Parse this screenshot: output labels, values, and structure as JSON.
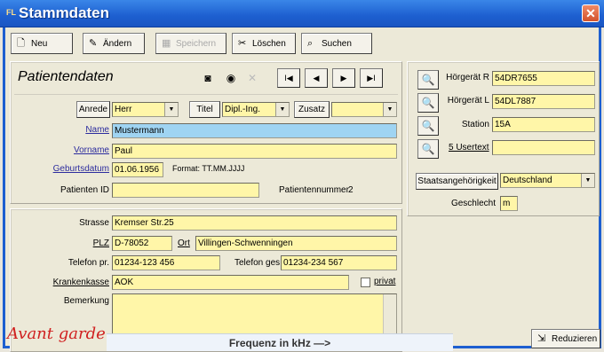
{
  "window": {
    "title": "Stammdaten",
    "app_icon": "FL"
  },
  "toolbar": {
    "new": "Neu",
    "edit": "Ändern",
    "save": "Speichern",
    "delete": "Löschen",
    "search": "Suchen",
    "reduce": "Reduzieren"
  },
  "patient": {
    "section_title": "Patientendaten",
    "anrede_label": "Anrede",
    "anrede_value": "Herr",
    "titel_label": "Titel",
    "titel_value": "Dipl.-Ing.",
    "zusatz_label": "Zusatz",
    "zusatz_value": "",
    "name_label": "Name",
    "name_value": "Mustermann",
    "vorname_label": "Vorname",
    "vorname_value": "Paul",
    "geburtsdatum_label": "Geburtsdatum",
    "geburtsdatum_value": "01.06.1956",
    "format_hint": "Format: TT.MM.JJJJ",
    "patienten_id_label": "Patienten ID",
    "patienten_id_value": "",
    "patientennummer_label": "Patientennummer",
    "patientennummer_value": "2"
  },
  "address": {
    "strasse_label": "Strasse",
    "strasse_value": "Kremser Str.25",
    "plz_label": "PLZ",
    "plz_value": "D-78052",
    "ort_label": "Ort",
    "ort_value": "Villingen-Schwenningen",
    "telefon_pr_label": "Telefon pr.",
    "telefon_pr_value": "01234-123 456",
    "telefon_ges_label": "Telefon ges.",
    "telefon_ges_value": "01234-234 567",
    "krankenkasse_label": "Krankenkasse",
    "krankenkasse_value": "AOK",
    "privat_label": "privat",
    "bemerkung_label": "Bemerkung",
    "bemerkung_value": ""
  },
  "device": {
    "hoergeraet_r_label": "Hörgerät R",
    "hoergeraet_r_value": "54DR7655",
    "hoergeraet_l_label": "Hörgerät L",
    "hoergeraet_l_value": "54DL7887",
    "station_label": "Station",
    "station_value": "15A",
    "usertext_label": "5 Usertext",
    "usertext_value": "",
    "staatsangehoerigkeit_label": "Staatsangehörigkeit",
    "staatsangehoerigkeit_value": "Deutschland",
    "geschlecht_label": "Geschlecht",
    "geschlecht_value": "m"
  },
  "footer": {
    "brand": "Avant garde",
    "frequency_label": "Frequenz in kHz —>"
  },
  "colors": {
    "field_bg": "#fff6a8",
    "active_field_bg": "#9fd4f2",
    "titlebar": "#1d5fd0"
  }
}
